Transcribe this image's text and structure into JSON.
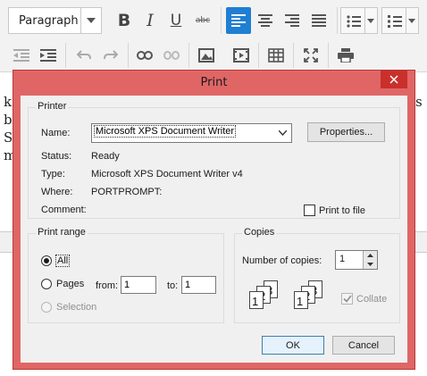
{
  "toolbar": {
    "paragraph_format": "Paragraph",
    "icons": [
      "bold-icon",
      "italic-icon",
      "underline-icon",
      "strikethrough-icon",
      "align-left-icon",
      "align-center-icon",
      "align-right-icon",
      "justify-icon",
      "bullet-list-icon",
      "numbered-list-icon",
      "outdent-icon",
      "indent-icon",
      "undo-icon",
      "redo-icon",
      "link-icon",
      "unlink-icon",
      "image-icon",
      "media-icon",
      "table-icon",
      "fullscreen-icon",
      "print-icon"
    ],
    "bold_glyph": "B",
    "italic_glyph": "I",
    "underline_glyph": "U",
    "strike_glyph": "abc",
    "accent_color": "#1f7fd3"
  },
  "editor": {
    "fragments_left": [
      "k",
      "b",
      "S",
      "m"
    ],
    "fragment_right": "s"
  },
  "dialog": {
    "title": "Print",
    "printer": {
      "group_label": "Printer",
      "name_label": "Name:",
      "name_value": "Microsoft XPS Document Writer",
      "properties_button": "Properties...",
      "status_label": "Status:",
      "status_value": "Ready",
      "type_label": "Type:",
      "type_value": "Microsoft XPS Document Writer v4",
      "where_label": "Where:",
      "where_value": "PORTPROMPT:",
      "comment_label": "Comment:",
      "print_to_file": "Print to file"
    },
    "print_range": {
      "group_label": "Print range",
      "all": "All",
      "pages": "Pages",
      "from_label": "from:",
      "from_value": "1",
      "to_label": "to:",
      "to_value": "1",
      "selection": "Selection"
    },
    "copies": {
      "group_label": "Copies",
      "number_label": "Number of copies:",
      "number_value": "1",
      "collate": "Collate",
      "page_numbers": [
        "1",
        "2",
        "3"
      ]
    },
    "ok_button": "OK",
    "cancel_button": "Cancel",
    "frame_color": "#e06666"
  }
}
